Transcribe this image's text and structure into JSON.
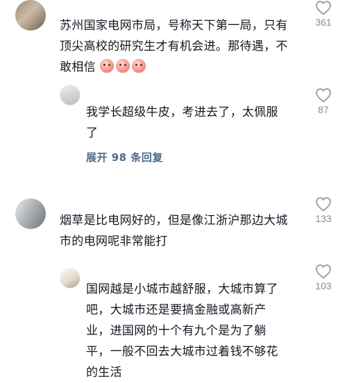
{
  "comments": [
    {
      "text": "苏州国家电网市局，号称天下第一局，只有顶尖高校的研究生才有机会进。那待遇，不敢相信",
      "likes": "361",
      "emoji": [
        "pig-emoji",
        "pig-emoji",
        "pig-emoji"
      ],
      "reply": {
        "text": "我学长超级牛皮，考进去了，太佩服了",
        "likes": "87"
      },
      "expand_label": "展开 98 条回复"
    },
    {
      "text": "烟草是比电网好的，但是像江浙沪那边大城市的电网呢非常能打",
      "likes": "133",
      "reply": {
        "text": "国网越是小城市越舒服，大城市算了吧，大城市还是要搞金融或高新产业，进国网的十个有九个是为了躺平，一般不回去大城市过着钱不够花的生活",
        "likes": "103"
      }
    }
  ],
  "lines": {
    "c1": [
      "苏州国家电网市局，号称天下第一局，只有",
      "顶尖高校的研究生才有机会进。那待遇，不",
      "敢相信"
    ],
    "r1": [
      "我学长超级牛皮，考进去了，太佩服",
      "了"
    ],
    "c2": [
      "烟草是比电网好的，但是像江浙沪那边大城",
      "市的电网呢非常能打"
    ],
    "r2": [
      "国网越是小城市越舒服，大城市算了",
      "吧，大城市还是要搞金融或高新产",
      "业，进国网的十个有九个是为了躺",
      "平，一般不回去大城市过着钱不够花",
      "的生活"
    ]
  },
  "colors": {
    "text": "#161823",
    "secondary": "#8a8b91",
    "link": "#4a6b8a"
  }
}
